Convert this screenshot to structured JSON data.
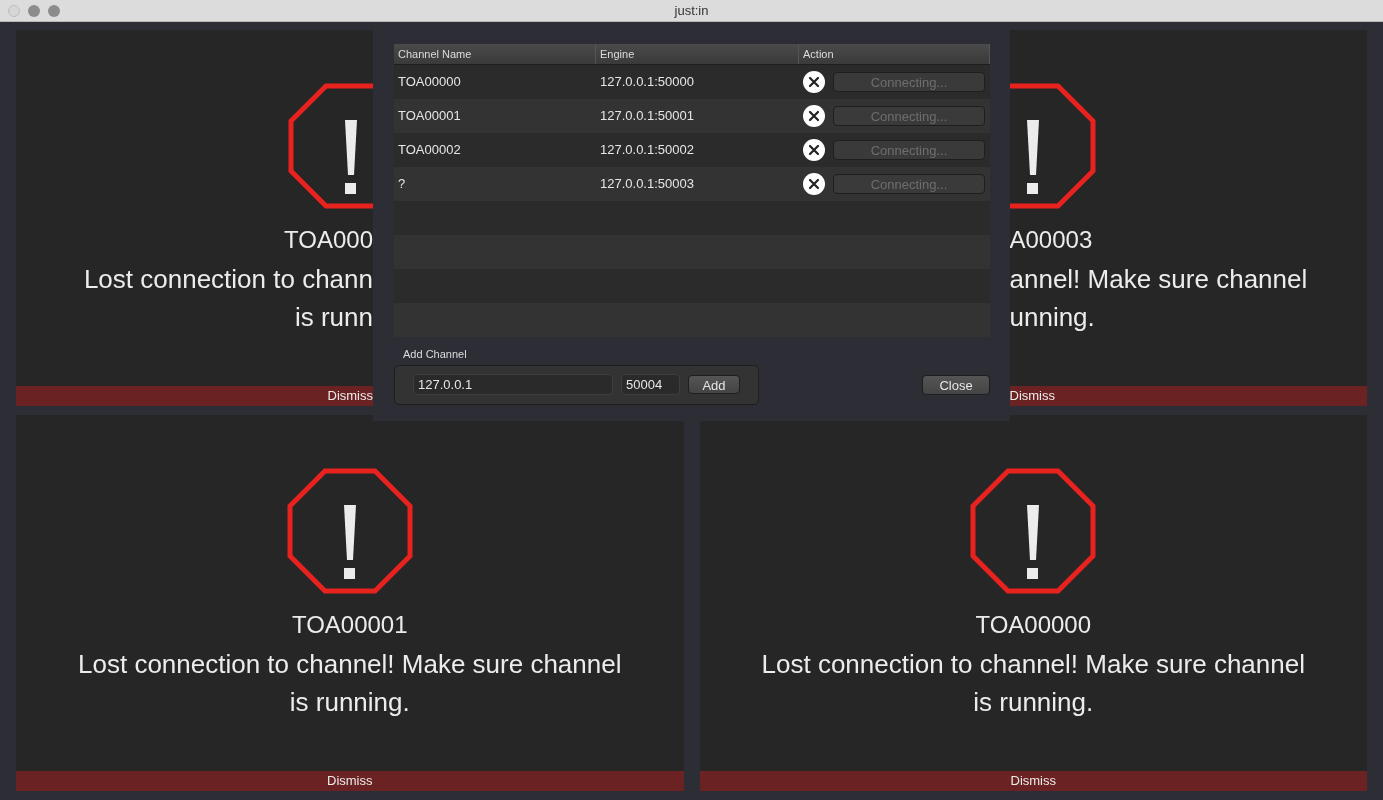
{
  "window": {
    "title": "just:in"
  },
  "panels": [
    {
      "kind": "covered_right",
      "title": "TOA000",
      "message": [
        "Lost connection to chann",
        "is runn"
      ],
      "dismiss": "Dismiss"
    },
    {
      "kind": "covered_left",
      "title": "A00003",
      "message": [
        "annel! Make sure channel",
        "unning."
      ],
      "dismiss": "Dismiss"
    },
    {
      "kind": "full",
      "title": "TOA00001",
      "message": [
        "Lost connection to channel! Make sure channel",
        "is running."
      ],
      "dismiss": "Dismiss"
    },
    {
      "kind": "full",
      "title": "TOA00000",
      "message": [
        "Lost connection to channel! Make sure channel",
        "is running."
      ],
      "dismiss": "Dismiss"
    }
  ],
  "dialog": {
    "table": {
      "columns": [
        "Channel Name",
        "Engine",
        "Action"
      ],
      "rows": [
        {
          "name": "TOA00000",
          "engine": "127.0.0.1:50000",
          "button": "Connecting...",
          "disabled": true
        },
        {
          "name": "TOA00001",
          "engine": "127.0.0.1:50001",
          "button": "Connecting...",
          "disabled": true
        },
        {
          "name": "TOA00002",
          "engine": "127.0.0.1:50002",
          "button": "Connecting...",
          "disabled": true
        },
        {
          "name": "?",
          "engine": "127.0.0.1:50003",
          "button": "Connecting...",
          "disabled": true
        }
      ]
    },
    "add_channel": {
      "label": "Add Channel",
      "host": "127.0.0.1",
      "port": "50004",
      "button": "Add"
    },
    "close_button": "Close"
  }
}
